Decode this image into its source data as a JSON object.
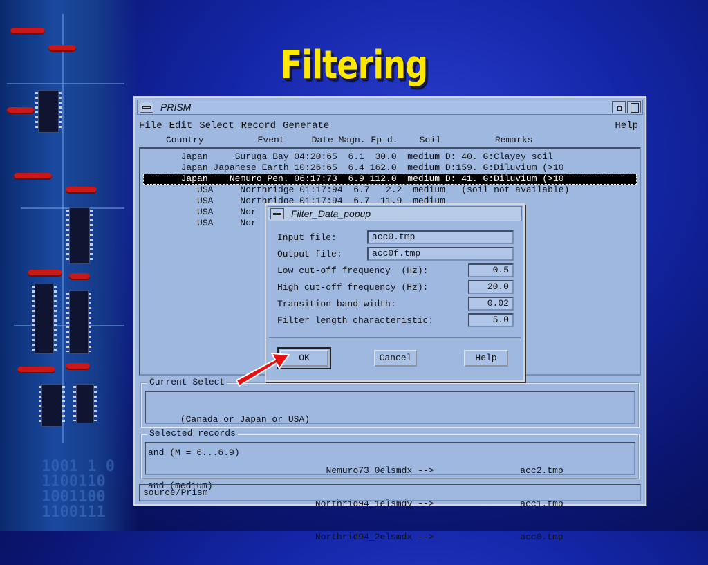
{
  "slide": {
    "title": "Filtering"
  },
  "decor": {
    "binary_lines": [
      "1001 1 0",
      "1100110",
      "1001100",
      "1100111"
    ]
  },
  "window": {
    "title": "PRISM",
    "menu": {
      "file": "File",
      "edit": "Edit",
      "select": "Select",
      "record": "Record",
      "generate": "Generate",
      "help": "Help"
    },
    "list_header": "     Country          Event     Date Magn. Ep-d.    Soil          Remarks",
    "records": [
      {
        "text": "       Japan     Suruga Bay 04:20:65  6.1  30.0  medium D: 40. G:Clayey soil",
        "selected": false
      },
      {
        "text": "       Japan Japanese Earth 10:26:65  6.4 162.0  medium D:159. G:Diluvium (>10",
        "selected": false
      },
      {
        "text": "       Japan    Nemuro Pen. 06:17:73  6.9 112.0  medium D: 41. G:Diluvium (>10",
        "selected": true
      },
      {
        "text": "          USA     Northridge 01:17:94  6.7   2.2  medium   (soil not available)",
        "selected": false
      },
      {
        "text": "          USA     Northridge 01:17:94  6.7  11.9  medium",
        "selected": false
      },
      {
        "text": "          USA     Nor",
        "selected": false
      },
      {
        "text": "          USA     Nor",
        "selected": false
      }
    ],
    "current_selection": {
      "label": "Current Select",
      "lines": [
        "      (Canada or Japan or USA)",
        "and (M = 6...6.9)",
        "and (medium)"
      ]
    },
    "selected_records": {
      "label": "Selected records",
      "lines": [
        "                                 Nemuro73_0elsmdx -->                acc2.tmp",
        "                               Northrid94_1elsmdy -->                acc1.tmp",
        "                               Northrid94_2elsmdx -->                acc0.tmp"
      ]
    },
    "status": "source/Prism"
  },
  "popup": {
    "title": "Filter_Data_popup",
    "input_file_label": "Input file:",
    "input_file": "acc0.tmp",
    "output_file_label": "Output file:",
    "output_file": "acc0f.tmp",
    "low_cutoff_label": "Low cut-off frequency  (Hz):",
    "low_cutoff": "0.5",
    "high_cutoff_label": "High cut-off frequency (Hz):",
    "high_cutoff": "20.0",
    "transition_label": "Transition band width:",
    "transition": "0.02",
    "filter_length_label": "Filter length characteristic:",
    "filter_length": "5.0",
    "ok": "OK",
    "cancel": "Cancel",
    "help": "Help"
  },
  "colors": {
    "title": "#ffe800",
    "window_bg": "#9fb8e0",
    "arrow": "#e81010"
  }
}
